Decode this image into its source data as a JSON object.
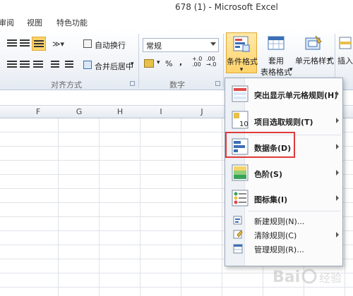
{
  "window": {
    "title": "678 (1)  -  Microsoft Excel"
  },
  "ribbon_tabs": [
    "审阅",
    "视图",
    "特色功能"
  ],
  "alignment_group": {
    "wrap_text": "自动换行",
    "merge_center": "合并后居中",
    "label": "对齐方式"
  },
  "number_group": {
    "format_value": "常规",
    "percent": "%",
    "comma": ",",
    "inc_decimal": "+.0\n.00",
    "dec_decimal": ".00\n→.0",
    "label": "数字"
  },
  "big_buttons": {
    "conditional_formatting": "条件格式",
    "format_as_table_line1": "套用",
    "format_as_table_line2": "表格格式",
    "cell_styles": "单元格样式",
    "insert": "插入"
  },
  "columns": [
    "F",
    "G",
    "H",
    "I",
    "J"
  ],
  "menu": {
    "items": [
      {
        "label": "突出显示单元格规则(H)",
        "has_submenu": true
      },
      {
        "label": "项目选取规则(T)",
        "has_submenu": true
      },
      {
        "label": "数据条(D)",
        "has_submenu": true
      },
      {
        "label": "色阶(S)",
        "has_submenu": true
      },
      {
        "label": "图标集(I)",
        "has_submenu": true
      },
      {
        "label": "新建规则(N)...",
        "has_submenu": false
      },
      {
        "label": "清除规则(C)",
        "has_submenu": true
      },
      {
        "label": "管理规则(R)...",
        "has_submenu": false
      }
    ],
    "highlighted_item": "数据条(D)"
  },
  "colors": {
    "highlight_border": "#e03a3a",
    "active_button": "#ffd36b"
  },
  "watermark": "Bai 经验"
}
